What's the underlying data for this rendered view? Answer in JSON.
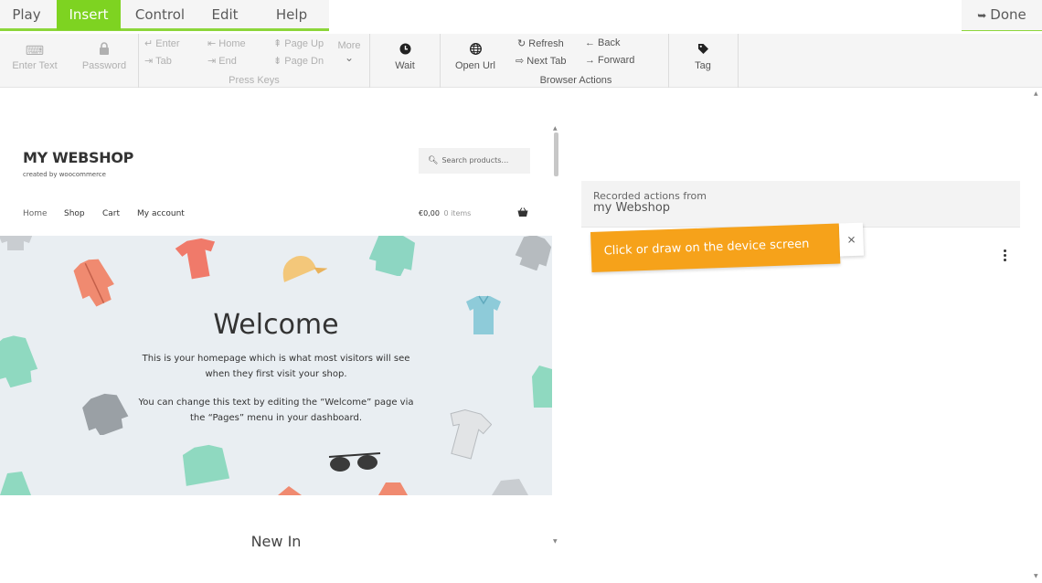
{
  "menu": {
    "tabs": [
      {
        "label": "Play"
      },
      {
        "label": "Insert"
      },
      {
        "label": "Control"
      },
      {
        "label": "Edit"
      },
      {
        "label": "Help"
      }
    ],
    "done_label": "Done",
    "accent_color": "#7ed321"
  },
  "toolbar": {
    "enter_text": "Enter Text",
    "password": "Password",
    "keys": {
      "enter": "↵ Enter",
      "tab": "⇥ Tab",
      "home": "⇤ Home",
      "end": "⇥ End",
      "page_up": "⇞ Page Up",
      "page_dn": "⇟ Page Dn",
      "more": "More",
      "group": "Press Keys"
    },
    "wait": "Wait",
    "open_url": "Open Url",
    "browser": {
      "refresh": "↻ Refresh",
      "next_tab": "⇨ Next Tab",
      "back": "← Back",
      "forward": "→ Forward",
      "group": "Browser Actions"
    },
    "tag": "Tag"
  },
  "device": {
    "site_title": "MY WEBSHOP",
    "site_tagline": "created by woocommerce",
    "search_placeholder": "Search products…",
    "nav": [
      "Home",
      "Shop",
      "Cart",
      "My account"
    ],
    "cart_total": "€0,00",
    "cart_items": "0 items",
    "hero": {
      "title": "Welcome",
      "p1": "This is your homepage which is what most visitors will see when they first visit your shop.",
      "p2": "You can change this text by editing the “Welcome” page via the “Pages” menu in your dashboard."
    },
    "section_title": "New In"
  },
  "panel": {
    "recorded_from": "Recorded actions from",
    "app_name": "my Webshop",
    "hint": "Click or draw on the device screen",
    "hint_close": "×",
    "hint_color": "#f6a21a"
  }
}
